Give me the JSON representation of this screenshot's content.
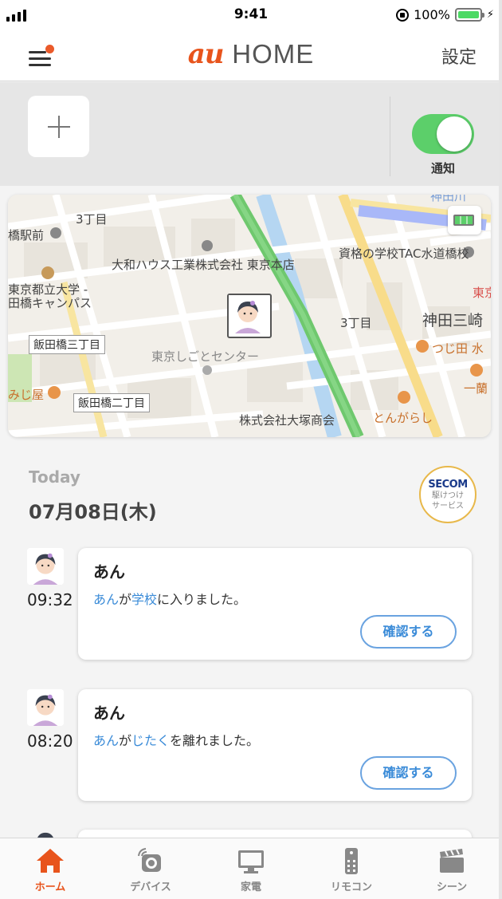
{
  "status_bar": {
    "time": "9:41",
    "battery": "100%"
  },
  "nav": {
    "brand_logo": "au",
    "brand_home": "HOME",
    "settings_label": "設定"
  },
  "top_panel": {
    "toggle_label": "通知",
    "toggle_on": true
  },
  "map": {
    "labels": {
      "l1": "3丁目",
      "l2": "橋駅前",
      "l3": "大和ハウス工業株式会社 東京本店",
      "l4": "資格の学校TAC水道橋校",
      "l5": "東京都立大学 -",
      "l6": "田橋キャンパス",
      "l7": "東京",
      "l8": "3丁目",
      "l9": "神田三崎",
      "l10": "飯田橋三丁目",
      "l11": "東京しごとセンター",
      "l12": "つじ田 水",
      "l13": "みじ屋",
      "l14": "一蘭",
      "l15": "飯田橋二丁目",
      "l16": "株式会社大塚商会",
      "l17": "とんがらし",
      "l18": "神田川"
    }
  },
  "feed": {
    "today_label": "Today",
    "date_label": "07月08日(木)",
    "secom": {
      "logo": "SECOM",
      "sub1": "駆けつけ",
      "sub2": "サービス"
    },
    "entries": [
      {
        "time": "09:32",
        "name": "あん",
        "msg_person": "あん",
        "msg_ga": "が",
        "msg_place": "学校",
        "msg_rest": "に入りました。",
        "button": "確認する"
      },
      {
        "time": "08:20",
        "name": "あん",
        "msg_person": "あん",
        "msg_ga": "が",
        "msg_place": "じたく",
        "msg_rest": "を離れました。",
        "button": "確認する"
      }
    ]
  },
  "tabs": [
    {
      "label": "ホーム",
      "active": true
    },
    {
      "label": "デバイス"
    },
    {
      "label": "家電"
    },
    {
      "label": "リモコン"
    },
    {
      "label": "シーン"
    }
  ],
  "colors": {
    "accent": "#e8541c",
    "link": "#3a8bd8",
    "toggle": "#5ccf6a"
  }
}
